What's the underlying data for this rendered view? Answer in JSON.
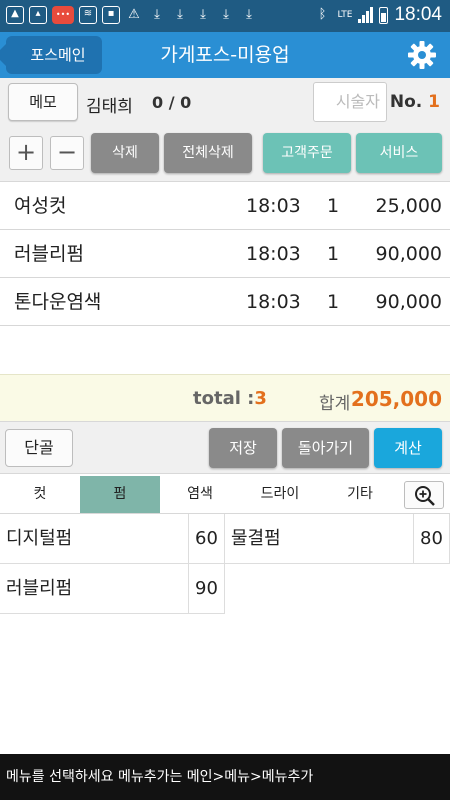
{
  "status_bar": {
    "time": "18:04",
    "network": "LTE"
  },
  "header": {
    "back_label": "포스메인",
    "title": "가게포스-미용업"
  },
  "customer": {
    "memo_label": "메모",
    "name": "김태희",
    "count": "0 / 0",
    "staff_placeholder": "시술자",
    "order_no_label": "No.",
    "order_no": "1"
  },
  "actions": {
    "plus": "+",
    "minus": "−",
    "delete": "삭제",
    "delete_all": "전체삭제",
    "customer_order": "고객주문",
    "service": "서비스"
  },
  "orders": [
    {
      "name": "여성컷",
      "time": "18:03",
      "qty": "1",
      "price": "25,000"
    },
    {
      "name": "러블리펌",
      "time": "18:03",
      "qty": "1",
      "price": "90,000"
    },
    {
      "name": "톤다운염색",
      "time": "18:03",
      "qty": "1",
      "price": "90,000"
    }
  ],
  "totals": {
    "total_label": "total :",
    "total_count": "3",
    "sum_label": "합계",
    "sum_value": "205,000"
  },
  "bottom_actions": {
    "regular": "단골",
    "save": "저장",
    "back": "돌아가기",
    "checkout": "계산"
  },
  "categories": [
    "컷",
    "펌",
    "염색",
    "드라이",
    "기타"
  ],
  "active_category": "펌",
  "menu_items": [
    {
      "name": "디지털펌",
      "price": "60"
    },
    {
      "name": "물결펌",
      "price": "80"
    },
    {
      "name": "러블리펌",
      "price": "90"
    }
  ],
  "footer": {
    "message": "메뉴를 선택하세요 메뉴추가는 메인>메뉴>메뉴추가"
  },
  "colors": {
    "status_bar": "#1f5b83",
    "header": "#2a8fd4",
    "accent_orange": "#e3701d",
    "teal_button": "#6cc2b6",
    "active_tab": "#7fb5a9",
    "checkout_button": "#1aa7dc"
  },
  "icons": {
    "status_left": [
      "gallery-icon",
      "image-icon",
      "app-badge-icon",
      "wifi-icon",
      "notification-icon",
      "warning-icon",
      "download-icon"
    ],
    "status_right": [
      "bluetooth-icon",
      "lte-icon",
      "signal-icon",
      "battery-icon"
    ],
    "header": "gear-icon",
    "zoom": "zoom-in-icon"
  }
}
